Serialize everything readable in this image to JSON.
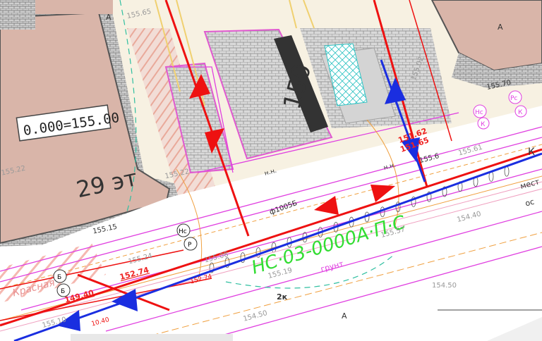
{
  "labels": {
    "building_level": "0.000=155.00",
    "floors": "29 эт",
    "plaza_level": "150",
    "crimson_line": "Красная",
    "pipe_main": "ф1005Б",
    "pipe_green": "НС·03-0000А·П·С",
    "elev_1": "155.22",
    "elev_2": "155.22",
    "elev_3": "155.65",
    "elev_4": "155.24",
    "elev_5": "152.74",
    "elev_6": "149.40",
    "elev_7": "155.19",
    "elev_8": "154.50",
    "elev_9": "154.50",
    "elev_10": "154.40",
    "elev_11": "155.57",
    "elev_12": "155.10",
    "elev_13": "155.08",
    "elev_14": "155.70",
    "elev_15": "155.6",
    "elev_16": "155.61",
    "elev_17": "155.02",
    "elev_18": "155.15",
    "road_label": "2к",
    "ground_label": "грунт",
    "zone_a_1": "А",
    "zone_a_2": "А",
    "zone_a_3": "А",
    "zone_k": "К",
    "nn_1": "н.н.",
    "nn_2": "н.н.",
    "right_label": "мест",
    "right_label_2": "ос",
    "badge_hc": "Нс",
    "badge_r": "Р",
    "badge_b": "Б",
    "badge_b2": "Б",
    "badge_pc": "Рс",
    "badge_nc": "Нс",
    "badge_k": "К",
    "badge_k2": "К",
    "red_elev": "151.62",
    "red_elev_2": "151.65",
    "red_label": "10.40",
    "red_label_2": "152.74"
  },
  "colors": {
    "red_line": "#ee1111",
    "blue_line": "#1a2ee0",
    "magenta": "#e040e0",
    "orange": "#f0a040",
    "building_fill": "#d8b4a8",
    "paving": "#b8b8b8",
    "green_text": "#33dd33"
  }
}
